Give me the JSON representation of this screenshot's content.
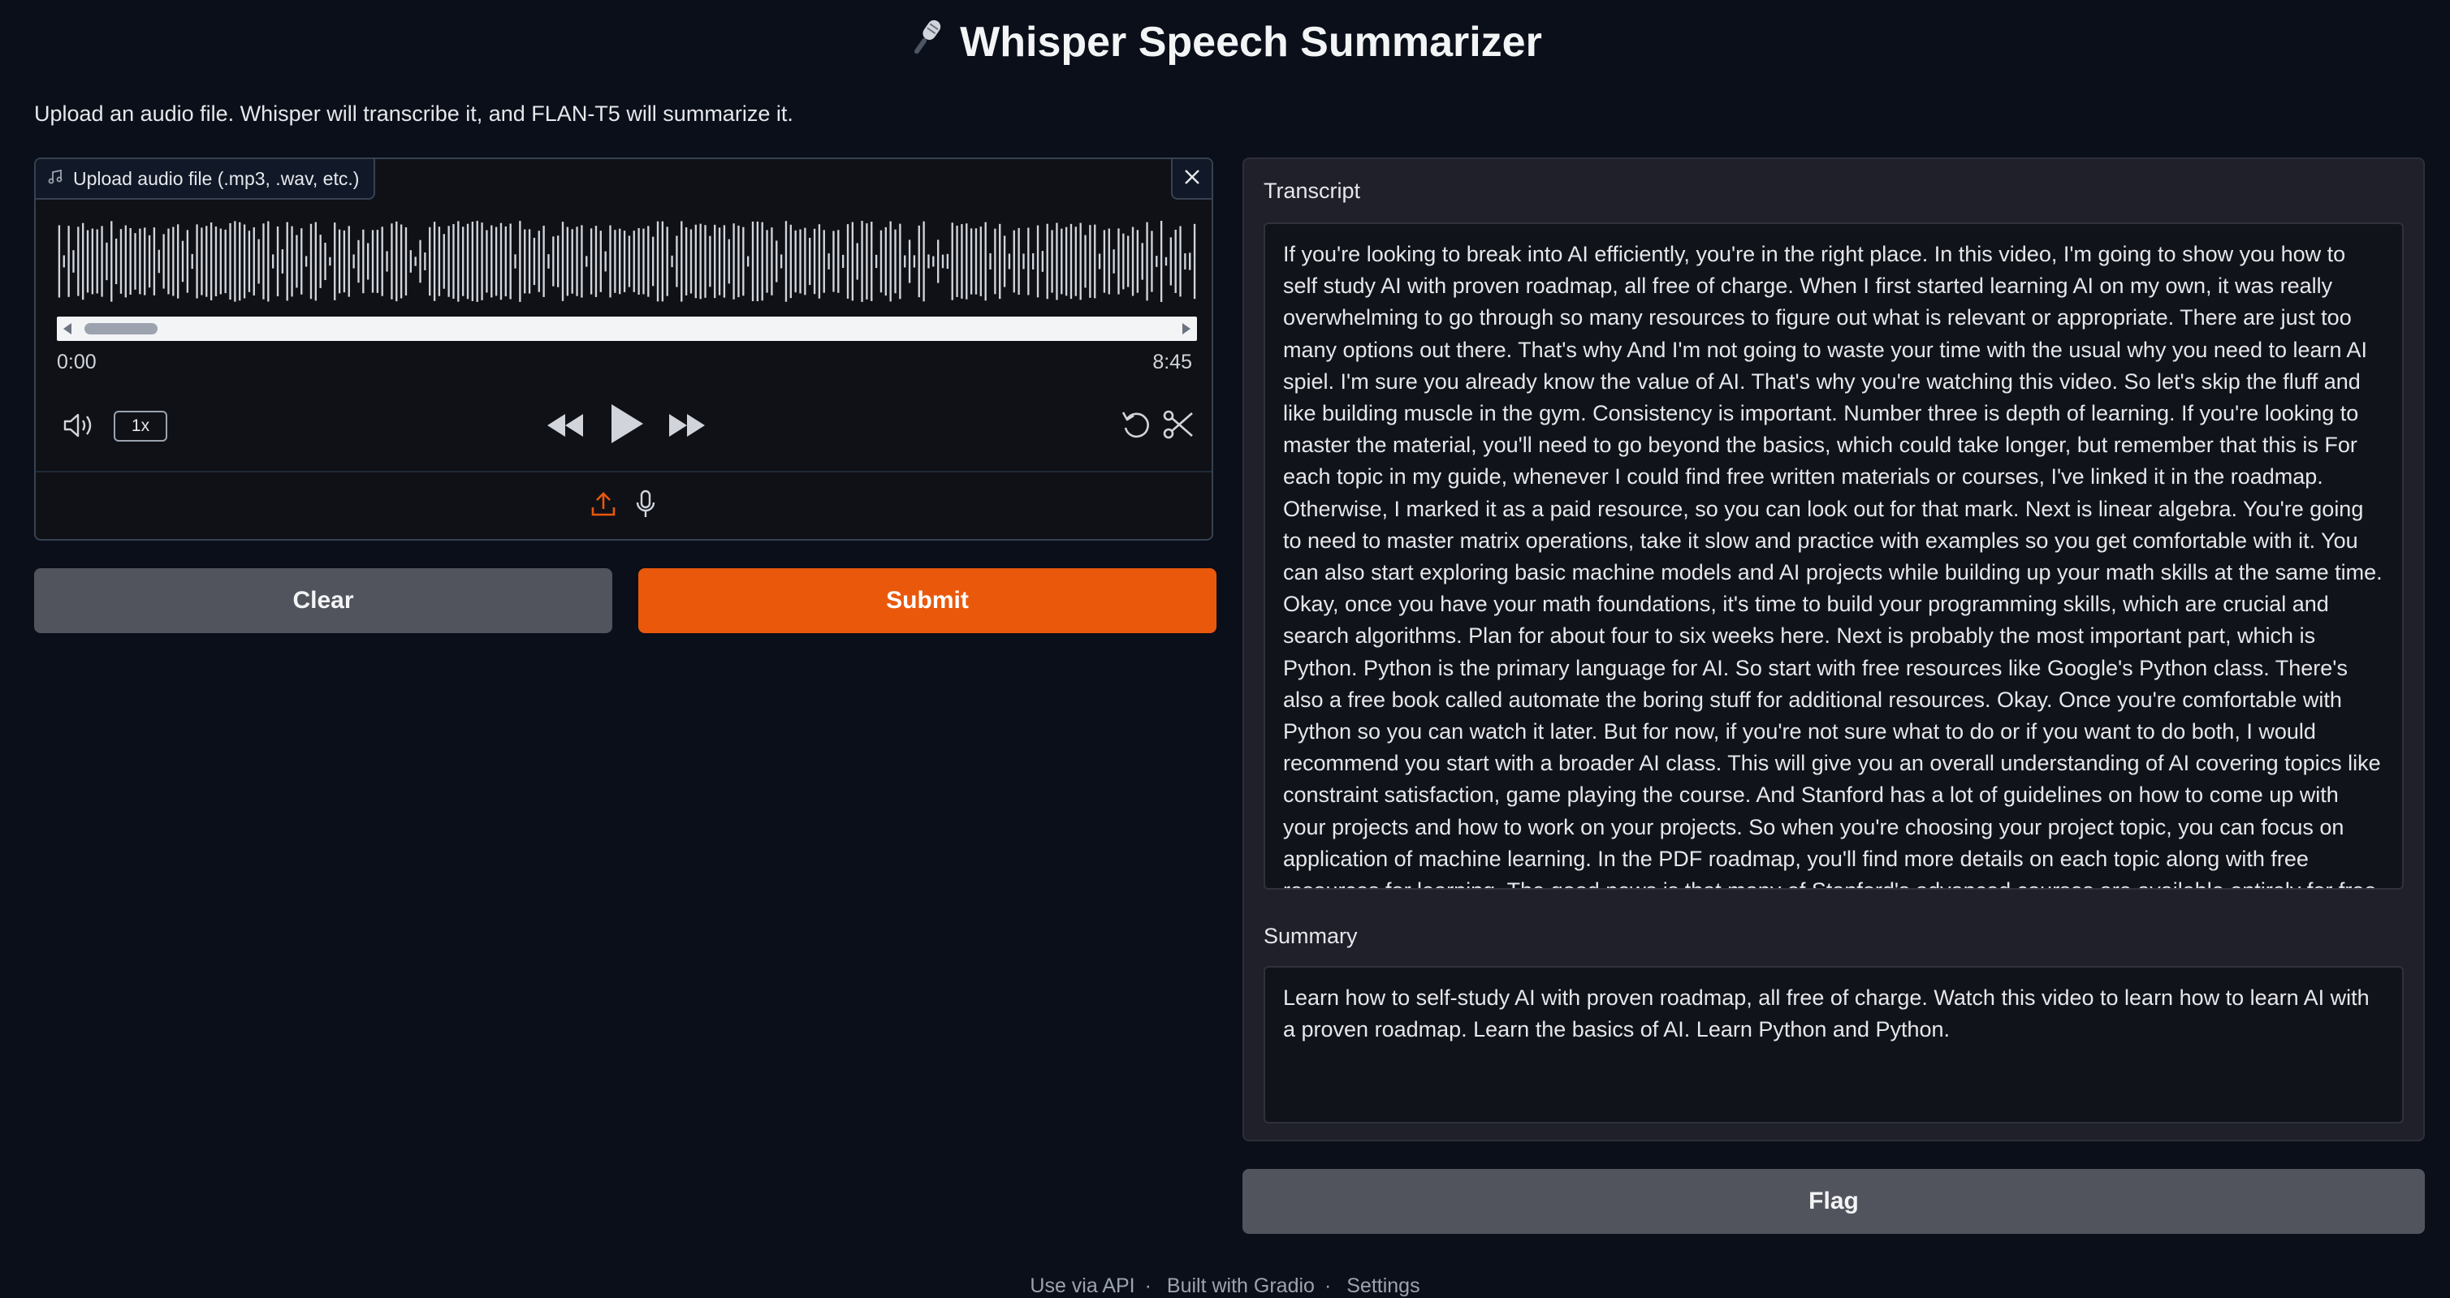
{
  "app": {
    "title": "Whisper Speech Summarizer",
    "title_icon": "microphone-emoji",
    "description": "Upload an audio file. Whisper will transcribe it, and FLAN-T5 will summarize it."
  },
  "audio": {
    "label": "Upload audio file (.mp3, .wav, etc.)",
    "current_time": "0:00",
    "duration": "8:45",
    "playback_speed": "1x",
    "icons": [
      "music-note-icon",
      "close-icon",
      "volume-icon",
      "rewind-icon",
      "play-icon",
      "fast-forward-icon",
      "reset-icon",
      "trim-scissors-icon",
      "upload-icon",
      "microphone-icon"
    ]
  },
  "buttons": {
    "clear": "Clear",
    "submit": "Submit",
    "flag": "Flag"
  },
  "output": {
    "transcript_label": "Transcript",
    "transcript": " If you're looking to break into AI efficiently, you're in the right place. In this video, I'm going to show you how to self study AI with proven roadmap, all free of charge. When I first started learning AI on my own, it was really overwhelming to go through so many resources to figure out what is relevant or appropriate. There are just too many options out there. That's why And I'm not going to waste your time with the usual why you need to learn AI spiel. I'm sure you already know the value of AI. That's why you're watching this video. So let's skip the fluff and like building muscle in the gym. Consistency is important. Number three is depth of learning. If you're looking to master the material, you'll need to go beyond the basics, which could take longer, but remember that this is For each topic in my guide, whenever I could find free written materials or courses, I've linked it in the roadmap. Otherwise, I marked it as a paid resource, so you can look out for that mark. Next is linear algebra. You're going to need to master matrix operations, take it slow and practice with examples so you get comfortable with it. You can also start exploring basic machine models and AI projects while building up your math skills at the same time. Okay, once you have your math foundations, it's time to build your programming skills, which are crucial and search algorithms. Plan for about four to six weeks here. Next is probably the most important part, which is Python. Python is the primary language for AI. So start with free resources like Google's Python class. There's also a free book called automate the boring stuff for additional resources. Okay. Once you're comfortable with Python so you can watch it later. But for now, if you're not sure what to do or if you want to do both, I would recommend you start with a broader AI class. This will give you an overall understanding of AI covering topics like constraint satisfaction, game playing the course. And Stanford has a lot of guidelines on how to come up with your projects and how to work on your projects. So when you're choosing your project topic, you can focus on application of machine learning. In the PDF roadmap, you'll find more details on each topic along with free resources for learning. The good news is that many of Stanford's advanced courses are available entirely for free online, either through YouTube or the Stanford website itself. It did take me some time to",
    "summary_label": "Summary",
    "summary": "Learn how to self-study AI with proven roadmap, all free of charge. Watch this video to learn how to learn AI with a proven roadmap. Learn the basics of AI. Learn Python and Python."
  },
  "footer": {
    "api": "Use via API",
    "built_with": "Built with Gradio",
    "settings": "Settings"
  },
  "colors": {
    "background": "#0b0f19",
    "accent": "#ea580c",
    "secondary_button": "#52545d",
    "panel": "#1f2029"
  }
}
